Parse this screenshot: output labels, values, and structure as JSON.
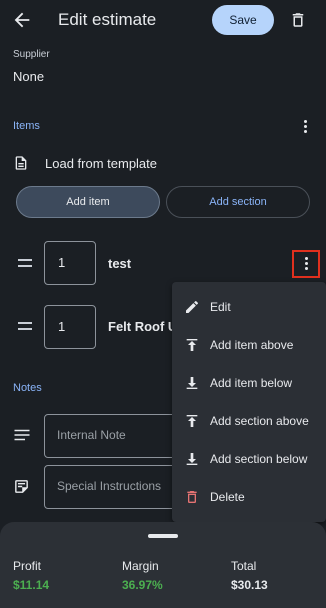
{
  "header": {
    "title": "Edit estimate",
    "save_label": "Save"
  },
  "supplier": {
    "label": "Supplier",
    "value": "None"
  },
  "items": {
    "section_label": "Items",
    "load_template": "Load from template",
    "add_item": "Add item",
    "add_section": "Add section",
    "rows": [
      {
        "qty": "1",
        "name": "test"
      },
      {
        "qty": "1",
        "name": "Felt Roof U"
      }
    ]
  },
  "notes": {
    "section_label": "Notes",
    "internal_placeholder": "Internal Note",
    "special_placeholder": "Special Instructions"
  },
  "menu": {
    "edit": "Edit",
    "add_item_above": "Add item above",
    "add_item_below": "Add item below",
    "add_section_above": "Add section above",
    "add_section_below": "Add section below",
    "delete": "Delete"
  },
  "summary": {
    "profit_label": "Profit",
    "profit_value": "$11.14",
    "margin_label": "Margin",
    "margin_value": "36.97%",
    "total_label": "Total",
    "total_value": "$30.13"
  },
  "colors": {
    "accent": "#8ab4f8",
    "save_bg": "#b6d4fb",
    "positive": "#4caf50",
    "delete": "#e57373"
  }
}
